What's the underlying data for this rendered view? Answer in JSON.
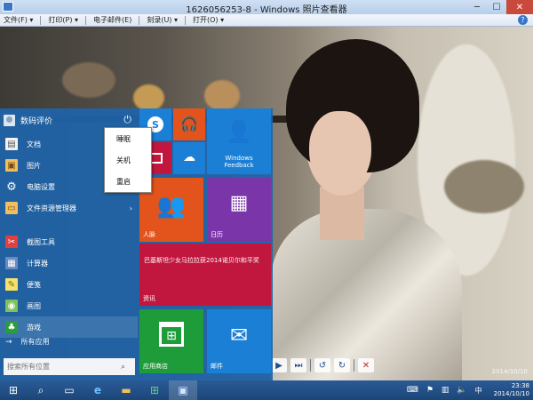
{
  "window": {
    "title": "1626056253-8 - Windows 照片查看器",
    "minimize_icon": "minimize-icon",
    "maximize_icon": "maximize-icon",
    "close_icon": "close-icon"
  },
  "menu": {
    "file": "文件(F) ▾",
    "print": "打印(P) ▾",
    "email": "电子邮件(E)",
    "burn": "刻录(U) ▾",
    "open": "打开(O) ▾"
  },
  "photo": {
    "watermark": "2014/10/10"
  },
  "start_menu": {
    "user_name": "数码评价",
    "power_menu": [
      "睡眠",
      "关机",
      "重启"
    ],
    "left_items": [
      {
        "label": "文档",
        "icon": "document-icon"
      },
      {
        "label": "图片",
        "icon": "pictures-icon"
      },
      {
        "label": "电脑设置",
        "icon": "settings-gear-icon"
      },
      {
        "label": "文件资源管理器",
        "icon": "file-explorer-icon"
      },
      {
        "label": "截图工具",
        "icon": "snipping-tool-icon"
      },
      {
        "label": "计算器",
        "icon": "calculator-icon"
      },
      {
        "label": "便笺",
        "icon": "sticky-notes-icon"
      },
      {
        "label": "画图",
        "icon": "paint-icon"
      },
      {
        "label": "游戏",
        "icon": "games-icon"
      }
    ],
    "all_apps": "所有应用",
    "search_placeholder": "搜索所有位置",
    "tiles": {
      "windows_feedback": "Windows Feedback",
      "people": "人脉",
      "calendar": "日历",
      "news_headline": "巴基斯坦少女马拉拉获2014诺贝尔和平奖",
      "news": "资讯",
      "store": "应用商店",
      "mail": "邮件"
    }
  },
  "taskbar": {
    "time": "23:38",
    "date": "2014/10/10"
  },
  "colors": {
    "start_bg": "#1e64aa",
    "tile_blue": "#1b7fd6",
    "tile_orange": "#e2541c",
    "tile_purple": "#7a35a9",
    "tile_crimson": "#c1163e",
    "tile_green": "#1f9c3a",
    "tile_red": "#d62d2d"
  }
}
